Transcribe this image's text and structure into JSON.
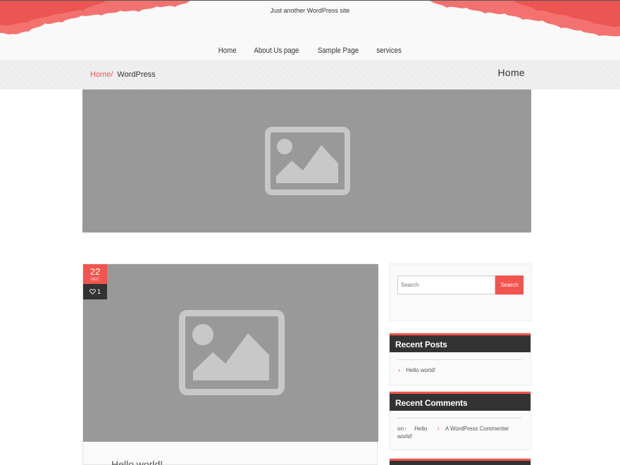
{
  "header": {
    "tagline": "Just another WordPress site",
    "nav": [
      "Home",
      "About Us page",
      "Sample Page",
      "services"
    ]
  },
  "breadcrumb": {
    "home": "Home",
    "separator": "/",
    "current": "WordPress",
    "page_title": "Home"
  },
  "post": {
    "day": "22",
    "month": "DEC",
    "likes": "1",
    "title_fragment": "Hello world!"
  },
  "sidebar": {
    "search": {
      "placeholder": "Search",
      "button": "Search"
    },
    "recent_posts": {
      "title": "Recent Posts",
      "items": [
        "Hello world!"
      ]
    },
    "recent_comments": {
      "title": "Recent Comments",
      "on": "on",
      "post": "Hello",
      "post_cont": "world!",
      "commenter": "A WordPress Commenter"
    }
  },
  "colors": {
    "accent": "#f25450",
    "placeholder_bg": "#999999",
    "placeholder_icon": "#c8c8c8",
    "dark": "#333333"
  },
  "icons": [
    "image-placeholder-icon",
    "heart-icon",
    "chevron-right-icon"
  ]
}
